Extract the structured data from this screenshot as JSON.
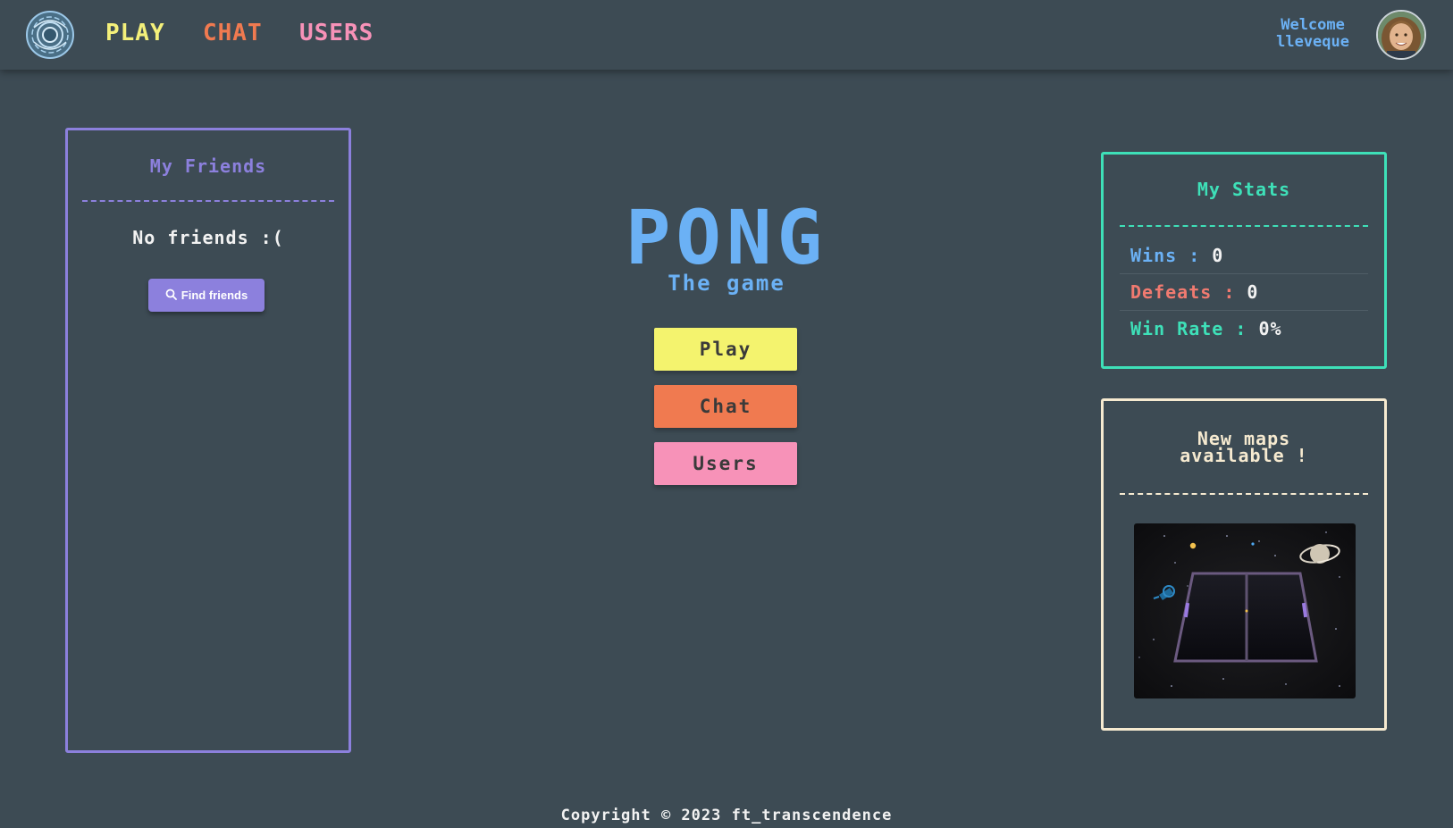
{
  "nav": {
    "links": [
      {
        "label": "PLAY",
        "color": "#f4f07a"
      },
      {
        "label": "CHAT",
        "color": "#f07a50"
      },
      {
        "label": "USERS",
        "color": "#f792b8"
      }
    ],
    "welcome_line1": "Welcome",
    "welcome_line2": "lleveque"
  },
  "friends": {
    "title": "My Friends",
    "empty_text": "No friends :(",
    "find_button": "Find friends"
  },
  "hero": {
    "title": "PONG",
    "subtitle": "The game"
  },
  "main_buttons": [
    {
      "label": "Play",
      "color": "#f4f36e"
    },
    {
      "label": "Chat",
      "color": "#f07a50"
    },
    {
      "label": "Users",
      "color": "#f792b8"
    }
  ],
  "stats": {
    "title": "My Stats",
    "wins_label": "Wins : ",
    "wins_value": "0",
    "defeats_label": "Defeats : ",
    "defeats_value": "0",
    "winrate_label": "Win Rate : ",
    "winrate_value": "0%"
  },
  "maps": {
    "title_line1": "New maps",
    "title_line2": "available !"
  },
  "footer": {
    "text": "Copyright © 2023 ft_transcendence"
  },
  "colors": {
    "background": "#3d4b54",
    "friends_border": "#8c80dd",
    "stats_border": "#3ee0b8",
    "maps_border": "#f6ead0",
    "accent_blue": "#6bb1f5",
    "defeats_red": "#f07a70"
  }
}
